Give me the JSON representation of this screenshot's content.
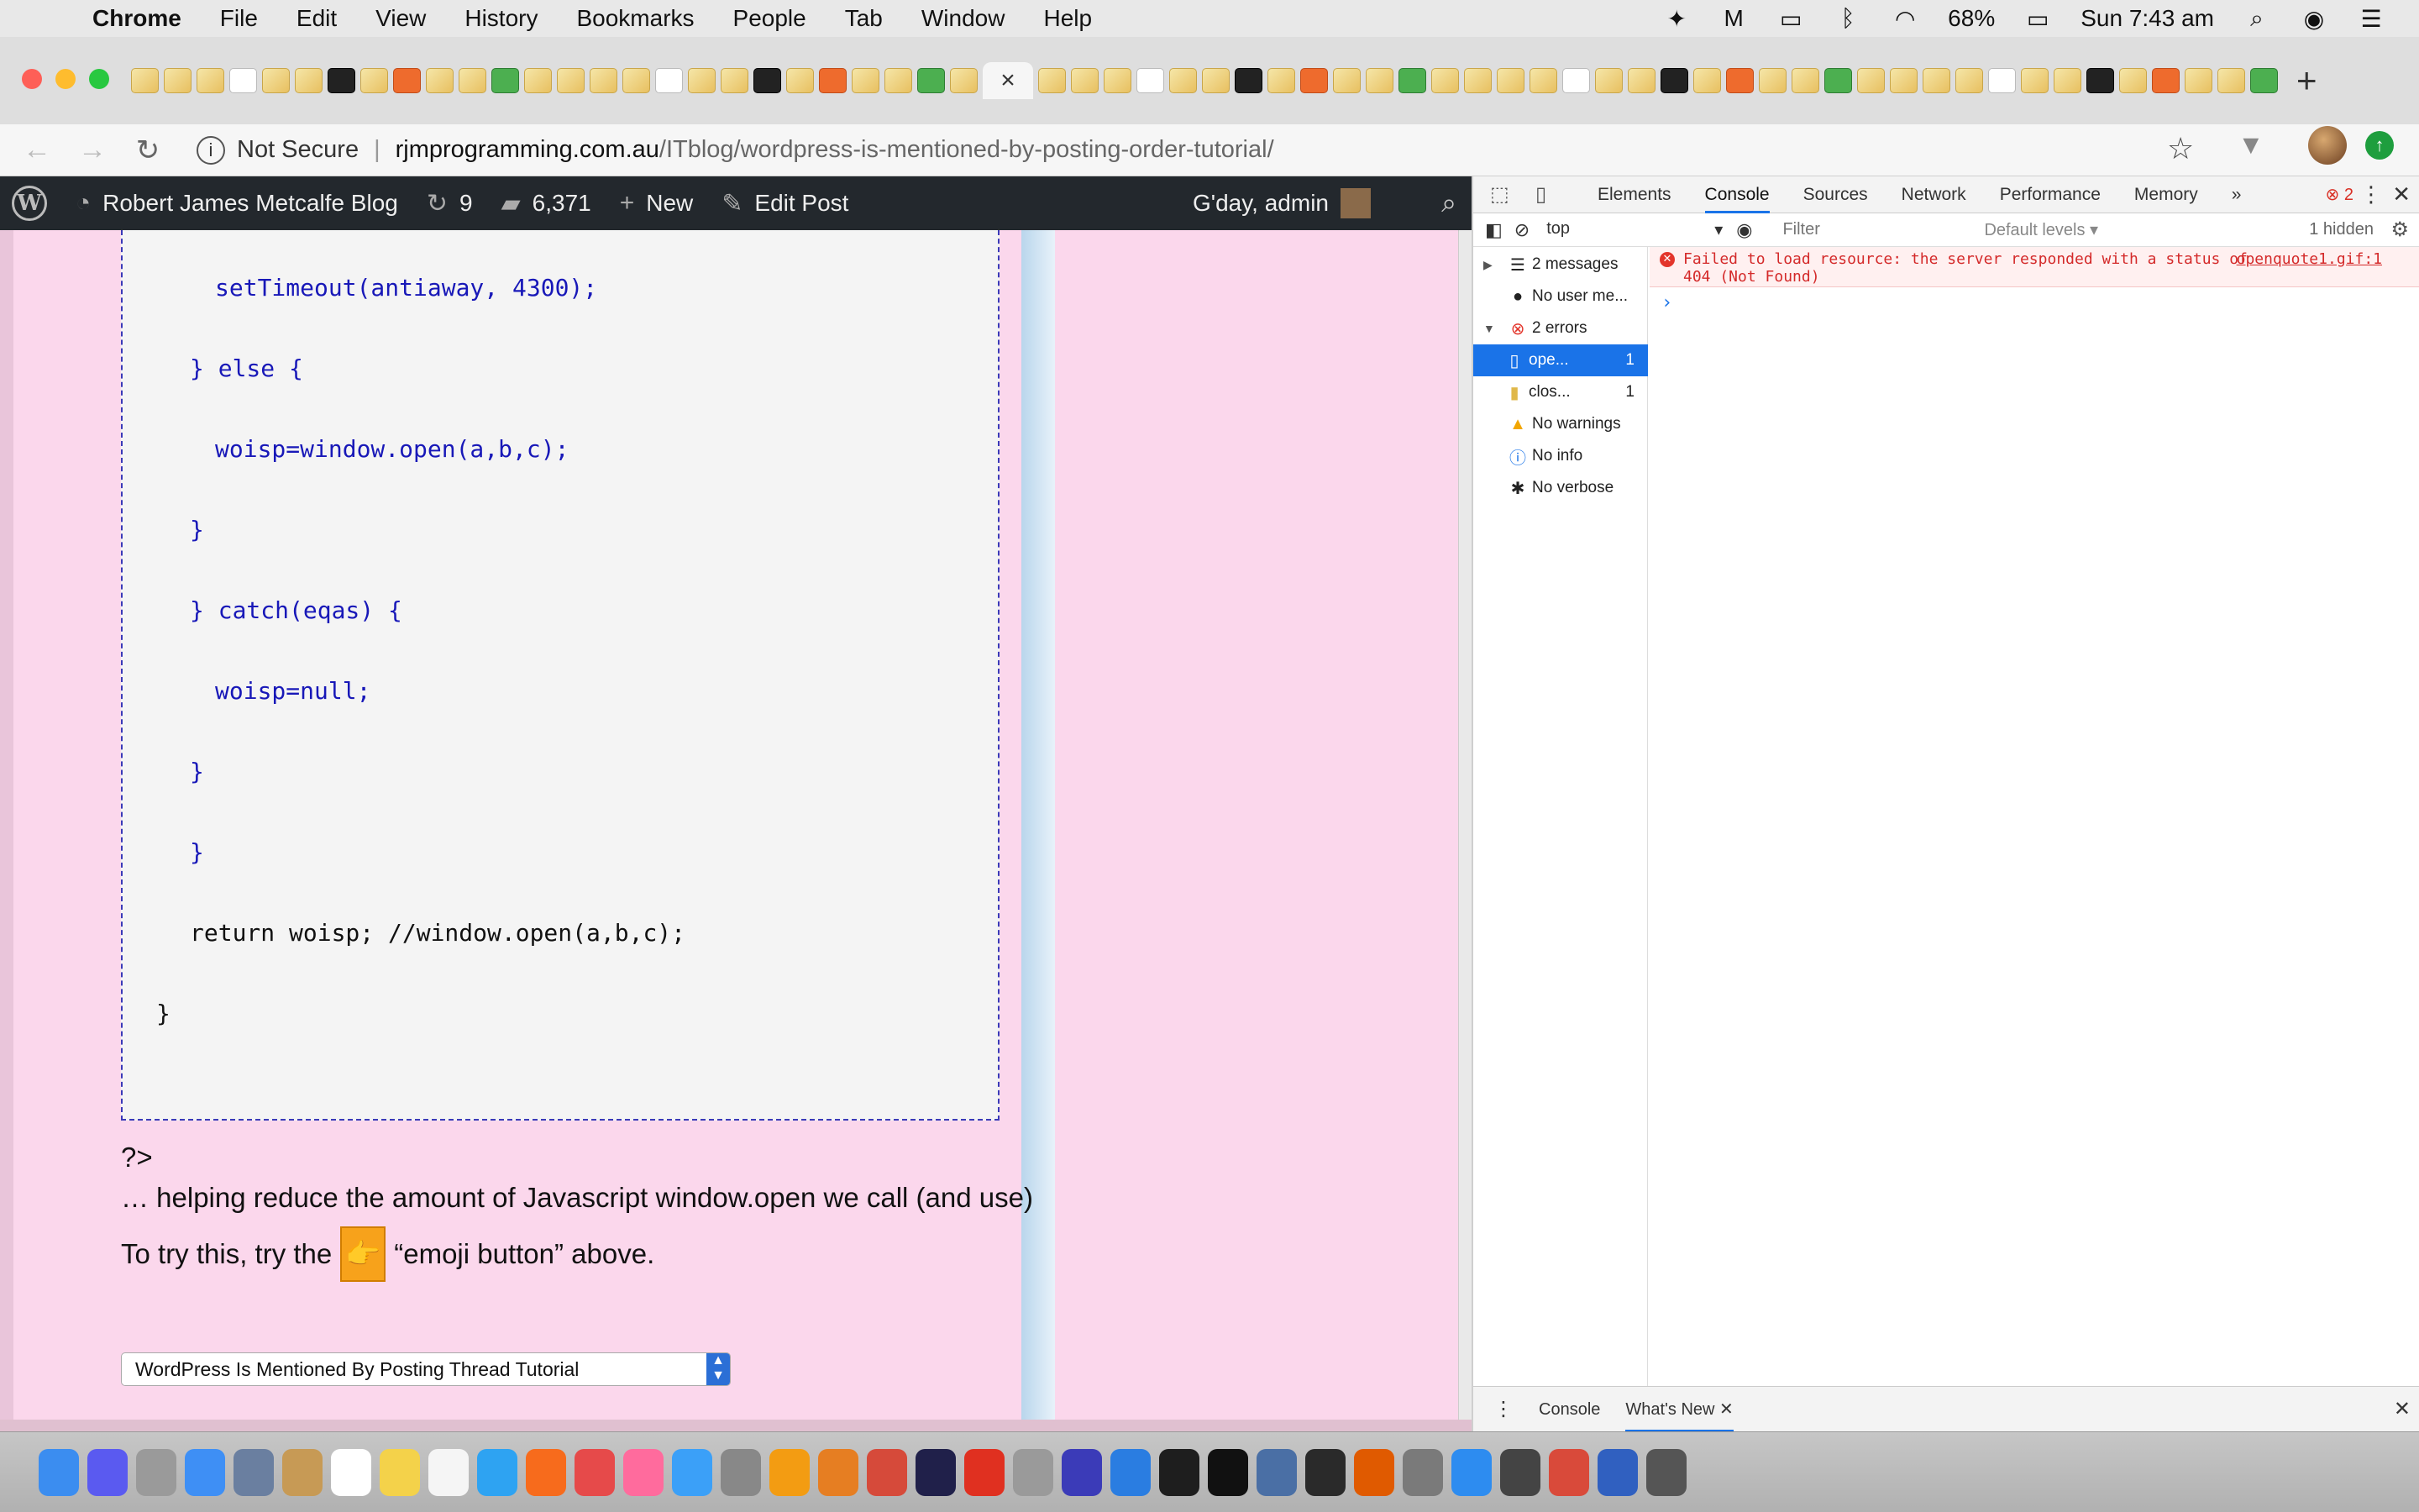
{
  "menubar": {
    "app_name": "Chrome",
    "menus": [
      "File",
      "Edit",
      "View",
      "History",
      "Bookmarks",
      "People",
      "Tab",
      "Window",
      "Help"
    ],
    "battery": "68%",
    "clock": "Sun 7:43 am"
  },
  "tabstrip": {
    "active_close_glyph": "×",
    "new_tab_glyph": "+",
    "favicon_count": 70
  },
  "address_bar": {
    "security_label": "Not Secure",
    "host": "rjmprogramming.com.au",
    "path": "/ITblog/wordpress-is-mentioned-by-posting-order-tutorial/"
  },
  "wp_admin_bar": {
    "site_name": "Robert James Metcalfe Blog",
    "updates_count": "9",
    "comments_count": "6,371",
    "new_label": "New",
    "edit_label": "Edit Post",
    "greeting": "G'day, admin"
  },
  "page": {
    "code_lines": [
      {
        "text": "setTimeout(antiaway, 4300);",
        "indent": 2
      },
      {
        "text": "} else {",
        "indent": 1
      },
      {
        "text": "woisp=window.open(a,b,c);",
        "indent": 2
      },
      {
        "text": "}",
        "indent": 1
      },
      {
        "text": "} catch(eqas) {",
        "indent": 1
      },
      {
        "text": "woisp=null;",
        "indent": 2
      },
      {
        "text": "}",
        "indent": 1
      },
      {
        "text": "}",
        "indent": 1
      },
      {
        "text": "return woisp; //window.open(a,b,c);",
        "indent": 1
      },
      {
        "text": "}",
        "indent": 0
      }
    ],
    "php_close": "?>",
    "helping_text": "… helping reduce the amount of Javascript window.open we call (and use)",
    "try_prefix": "To try this, try the",
    "emoji": "👉",
    "try_suffix": "“emoji button” above.",
    "thread_select_value": "WordPress Is Mentioned By Posting Thread Tutorial"
  },
  "devtools": {
    "tabs": [
      "Elements",
      "Console",
      "Sources",
      "Network",
      "Performance",
      "Memory"
    ],
    "active_tab": "Console",
    "more_tabs": "»",
    "error_badge": "2",
    "context": "top",
    "filter_placeholder": "Filter",
    "levels": "Default levels ▾",
    "hidden_count": "1 hidden",
    "sidebar": [
      {
        "label": "2 messages",
        "count": ""
      },
      {
        "label": "No user me...",
        "count": ""
      },
      {
        "label": "2 errors",
        "count": ""
      },
      {
        "label": "ope...",
        "count": "1"
      },
      {
        "label": "clos...",
        "count": "1"
      },
      {
        "label": "No warnings",
        "count": ""
      },
      {
        "label": "No info",
        "count": ""
      },
      {
        "label": "No verbose",
        "count": ""
      }
    ],
    "error_message_line1": "Failed to load resource: the server responded with a status of",
    "error_message_line2": "404 (Not Found)",
    "error_source": "openquote1.gif:1",
    "prompt": "›",
    "drawer_tabs": [
      "Console",
      "What's New"
    ]
  },
  "colors": {
    "page_background": "#fbd7ec",
    "code_keyword": "#1818b8",
    "wp_bar": "#23282d",
    "error_red": "#d42a2a",
    "devtools_accent": "#1a73e8"
  }
}
